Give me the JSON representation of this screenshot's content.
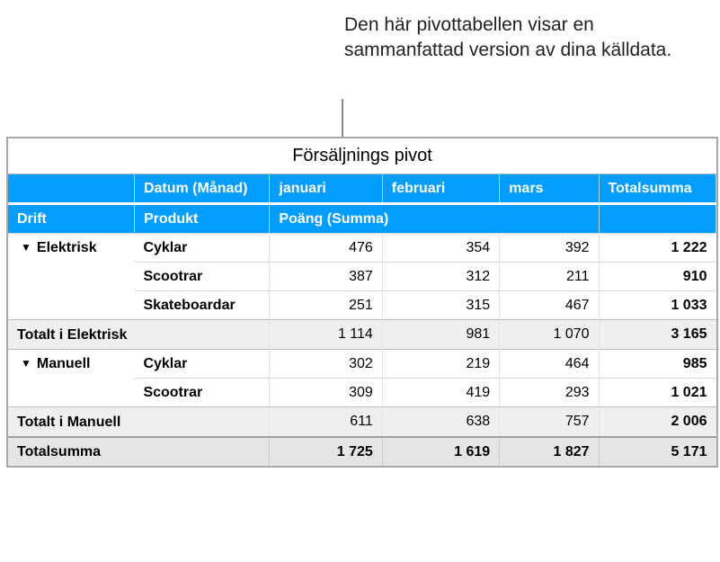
{
  "callout_text": "Den här pivottabellen visar en sammanfattad version av dina källdata.",
  "title": "Försäljnings pivot",
  "header1": {
    "blank": "",
    "date": "Datum (Månad)",
    "months": [
      "januari",
      "februari",
      "mars"
    ],
    "total": "Totalsumma"
  },
  "header2": {
    "drift": "Drift",
    "produkt": "Produkt",
    "poang": "Poäng (Summa)",
    "blank": ""
  },
  "groups": [
    {
      "name": "Elektrisk",
      "rows": [
        {
          "label": "Cyklar",
          "vals": [
            "476",
            "354",
            "392"
          ],
          "total": "1 222"
        },
        {
          "label": "Scootrar",
          "vals": [
            "387",
            "312",
            "211"
          ],
          "total": "910"
        },
        {
          "label": "Skateboardar",
          "vals": [
            "251",
            "315",
            "467"
          ],
          "total": "1 033"
        }
      ],
      "subtotal_label": "Totalt i Elektrisk",
      "subtotal": {
        "vals": [
          "1 114",
          "981",
          "1 070"
        ],
        "total": "3 165"
      }
    },
    {
      "name": "Manuell",
      "rows": [
        {
          "label": "Cyklar",
          "vals": [
            "302",
            "219",
            "464"
          ],
          "total": "985"
        },
        {
          "label": "Scootrar",
          "vals": [
            "309",
            "419",
            "293"
          ],
          "total": "1 021"
        }
      ],
      "subtotal_label": "Totalt i Manuell",
      "subtotal": {
        "vals": [
          "611",
          "638",
          "757"
        ],
        "total": "2 006"
      }
    }
  ],
  "grand_label": "Totalsumma",
  "grand": {
    "vals": [
      "1 725",
      "1 619",
      "1 827"
    ],
    "total": "5 171"
  }
}
